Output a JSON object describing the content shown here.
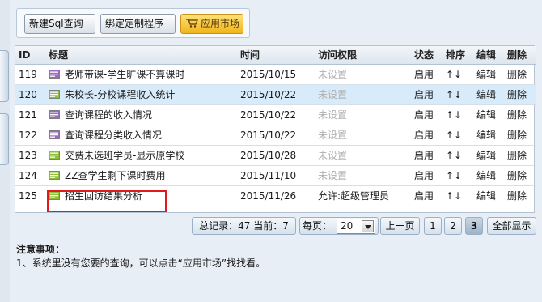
{
  "toolbar": {
    "new_sql": "新建Sql查询",
    "bind_program": "绑定定制程序",
    "app_market": "应用市场"
  },
  "table": {
    "headers": {
      "id": "ID",
      "title": "标题",
      "time": "时间",
      "access": "访问权限",
      "status": "状态",
      "sort": "排序",
      "edit": "编辑",
      "delete": "删除"
    },
    "rows": [
      {
        "id": "119",
        "title": "老师带课-学生旷课不算课时",
        "time": "2015/10/15",
        "access": "未设置",
        "status": "启用",
        "sort": "↑↓",
        "edit": "编辑",
        "delete": "删除",
        "icon": "purple"
      },
      {
        "id": "120",
        "title": "朱校长-分校课程收入统计",
        "time": "2015/10/22",
        "access": "未设置",
        "status": "启用",
        "sort": "↑↓",
        "edit": "编辑",
        "delete": "删除",
        "icon": "green"
      },
      {
        "id": "121",
        "title": "查询课程的收入情况",
        "time": "2015/10/22",
        "access": "未设置",
        "status": "启用",
        "sort": "↑↓",
        "edit": "编辑",
        "delete": "删除",
        "icon": "purple"
      },
      {
        "id": "122",
        "title": "查询课程分类收入情况",
        "time": "2015/10/22",
        "access": "未设置",
        "status": "启用",
        "sort": "↑↓",
        "edit": "编辑",
        "delete": "删除",
        "icon": "purple"
      },
      {
        "id": "123",
        "title": "交费未选班学员-显示原学校",
        "time": "2015/10/28",
        "access": "未设置",
        "status": "启用",
        "sort": "↑↓",
        "edit": "编辑",
        "delete": "删除",
        "icon": "green"
      },
      {
        "id": "124",
        "title": "ZZ查学生剩下课时费用",
        "time": "2015/11/10",
        "access": "未设置",
        "status": "启用",
        "sort": "↑↓",
        "edit": "编辑",
        "delete": "删除",
        "icon": "green"
      },
      {
        "id": "125",
        "title": "招生回访结果分析",
        "time": "2015/11/26",
        "access": "允许:超级管理员",
        "status": "启用",
        "sort": "↑↓",
        "edit": "编辑",
        "delete": "删除",
        "icon": "green"
      }
    ]
  },
  "pager": {
    "summary": "总记录：47 当前：7",
    "per_page_label": "每页：",
    "per_page_value": "20",
    "prev": "上一页",
    "pages": [
      "1",
      "2",
      "3"
    ],
    "current_page": "3",
    "show_all": "全部显示"
  },
  "notes": {
    "heading": "注意事项：",
    "line1": "1、系统里没有您要的查询，可以点击“应用市场”找找看。"
  },
  "colors": {
    "icon_purple": "#9a6bc2",
    "icon_green": "#8fbf3a",
    "highlight": "#e01a1a",
    "selected_row": "#d8ebfa"
  }
}
